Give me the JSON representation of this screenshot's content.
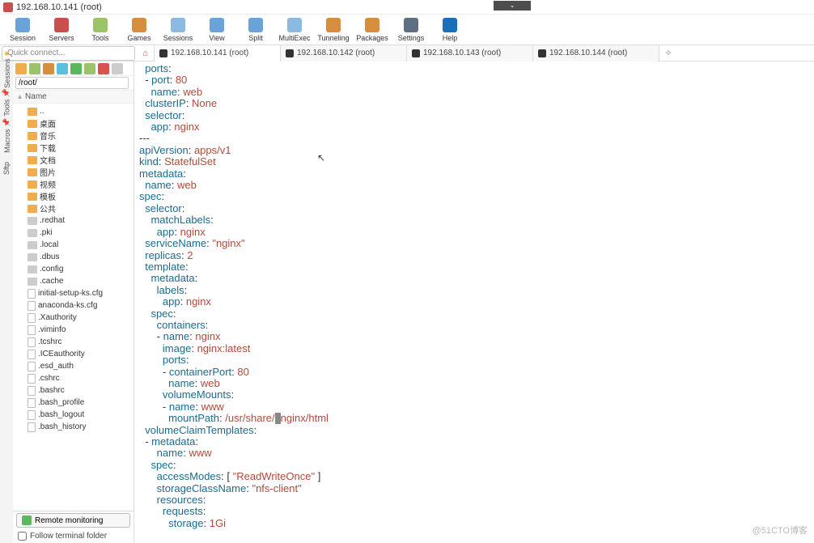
{
  "window_title": "192.168.10.141 (root)",
  "toolbar": [
    {
      "label": "Session",
      "color": "#6aa3d8"
    },
    {
      "label": "Servers",
      "color": "#c94f4f"
    },
    {
      "label": "Tools",
      "color": "#9cc26a"
    },
    {
      "label": "Games",
      "color": "#d68f3e"
    },
    {
      "label": "Sessions",
      "color": "#8bb9e0"
    },
    {
      "label": "View",
      "color": "#6aa3d8"
    },
    {
      "label": "Split",
      "color": "#6aa3d8"
    },
    {
      "label": "MultiExec",
      "color": "#8bb9e0"
    },
    {
      "label": "Tunneling",
      "color": "#d68f3e"
    },
    {
      "label": "Packages",
      "color": "#d68f3e"
    },
    {
      "label": "Settings",
      "color": "#5e6f82"
    },
    {
      "label": "Help",
      "color": "#1b6fb8"
    }
  ],
  "quick_connect_placeholder": "Quick connect...",
  "tabs": [
    {
      "label": "192.168.10.141 (root)",
      "active": true
    },
    {
      "label": "192.168.10.142 (root)",
      "active": false
    },
    {
      "label": "192.168.10.143 (root)",
      "active": false
    },
    {
      "label": "192.168.10.144 (root)",
      "active": false
    }
  ],
  "vtabs": [
    "Sessions",
    "Tools",
    "Macros",
    "Sftp"
  ],
  "sidebar": {
    "path_value": "/root/",
    "name_header": "Name",
    "tree": [
      {
        "t": "up",
        "label": ".."
      },
      {
        "t": "fld",
        "label": "桌面"
      },
      {
        "t": "fld",
        "label": "音乐"
      },
      {
        "t": "fld",
        "label": "下载"
      },
      {
        "t": "fld",
        "label": "文档"
      },
      {
        "t": "fld",
        "label": "图片"
      },
      {
        "t": "fld",
        "label": "视频"
      },
      {
        "t": "fld",
        "label": "模板"
      },
      {
        "t": "fld",
        "label": "公共"
      },
      {
        "t": "fldg",
        "label": ".redhat"
      },
      {
        "t": "fldg",
        "label": ".pki"
      },
      {
        "t": "fldg",
        "label": ".local"
      },
      {
        "t": "fldg",
        "label": ".dbus"
      },
      {
        "t": "fldg",
        "label": ".config"
      },
      {
        "t": "fldg",
        "label": ".cache"
      },
      {
        "t": "fl",
        "label": "initial-setup-ks.cfg"
      },
      {
        "t": "fl",
        "label": "anaconda-ks.cfg"
      },
      {
        "t": "fl",
        "label": ".Xauthority"
      },
      {
        "t": "fl",
        "label": ".viminfo"
      },
      {
        "t": "fl",
        "label": ".tcshrc"
      },
      {
        "t": "fl",
        "label": ".ICEauthority"
      },
      {
        "t": "fl",
        "label": ".esd_auth"
      },
      {
        "t": "fl",
        "label": ".cshrc"
      },
      {
        "t": "fl",
        "label": ".bashrc"
      },
      {
        "t": "fl",
        "label": ".bash_profile"
      },
      {
        "t": "fl",
        "label": ".bash_logout"
      },
      {
        "t": "fl",
        "label": ".bash_history"
      }
    ],
    "remote_monitoring": "Remote monitoring",
    "follow_terminal": "Follow terminal folder"
  },
  "terminal_lines": [
    [
      [
        "k",
        "  ports"
      ],
      [
        "p",
        ":"
      ]
    ],
    [
      [
        "d",
        "  - "
      ],
      [
        "k",
        "port"
      ],
      [
        "p",
        ": "
      ],
      [
        "n",
        "80"
      ]
    ],
    [
      [
        "p",
        "    "
      ],
      [
        "k",
        "name"
      ],
      [
        "p",
        ": "
      ],
      [
        "s",
        "web"
      ]
    ],
    [
      [
        "p",
        "  "
      ],
      [
        "k",
        "clusterIP"
      ],
      [
        "p",
        ": "
      ],
      [
        "s",
        "None"
      ]
    ],
    [
      [
        "p",
        "  "
      ],
      [
        "k",
        "selector"
      ],
      [
        "p",
        ":"
      ]
    ],
    [
      [
        "p",
        "    "
      ],
      [
        "k",
        "app"
      ],
      [
        "p",
        ": "
      ],
      [
        "s",
        "nginx"
      ]
    ],
    [
      [
        "d",
        "---"
      ]
    ],
    [
      [
        "k",
        "apiVersion"
      ],
      [
        "p",
        ": "
      ],
      [
        "s",
        "apps/v1"
      ]
    ],
    [
      [
        "k",
        "kind"
      ],
      [
        "p",
        ": "
      ],
      [
        "s",
        "StatefulSet"
      ]
    ],
    [
      [
        "k",
        "metadata"
      ],
      [
        "p",
        ":"
      ]
    ],
    [
      [
        "p",
        "  "
      ],
      [
        "k",
        "name"
      ],
      [
        "p",
        ": "
      ],
      [
        "s",
        "web"
      ]
    ],
    [
      [
        "k",
        "spec"
      ],
      [
        "p",
        ":"
      ]
    ],
    [
      [
        "p",
        "  "
      ],
      [
        "k",
        "selector"
      ],
      [
        "p",
        ":"
      ]
    ],
    [
      [
        "p",
        "    "
      ],
      [
        "k",
        "matchLabels"
      ],
      [
        "p",
        ":"
      ]
    ],
    [
      [
        "p",
        "      "
      ],
      [
        "k",
        "app"
      ],
      [
        "p",
        ": "
      ],
      [
        "s",
        "nginx"
      ]
    ],
    [
      [
        "p",
        "  "
      ],
      [
        "k",
        "serviceName"
      ],
      [
        "p",
        ": "
      ],
      [
        "s",
        "\"nginx\""
      ]
    ],
    [
      [
        "p",
        "  "
      ],
      [
        "k",
        "replicas"
      ],
      [
        "p",
        ": "
      ],
      [
        "n",
        "2"
      ]
    ],
    [
      [
        "p",
        "  "
      ],
      [
        "k",
        "template"
      ],
      [
        "p",
        ":"
      ]
    ],
    [
      [
        "p",
        "    "
      ],
      [
        "k",
        "metadata"
      ],
      [
        "p",
        ":"
      ]
    ],
    [
      [
        "p",
        "      "
      ],
      [
        "k",
        "labels"
      ],
      [
        "p",
        ":"
      ]
    ],
    [
      [
        "p",
        "        "
      ],
      [
        "k",
        "app"
      ],
      [
        "p",
        ": "
      ],
      [
        "s",
        "nginx"
      ]
    ],
    [
      [
        "p",
        "    "
      ],
      [
        "k",
        "spec"
      ],
      [
        "p",
        ":"
      ]
    ],
    [
      [
        "p",
        "      "
      ],
      [
        "k",
        "containers"
      ],
      [
        "p",
        ":"
      ]
    ],
    [
      [
        "d",
        "      - "
      ],
      [
        "k",
        "name"
      ],
      [
        "p",
        ": "
      ],
      [
        "s",
        "nginx"
      ]
    ],
    [
      [
        "p",
        "        "
      ],
      [
        "k",
        "image"
      ],
      [
        "p",
        ": "
      ],
      [
        "s",
        "nginx:latest"
      ]
    ],
    [
      [
        "p",
        "        "
      ],
      [
        "k",
        "ports"
      ],
      [
        "p",
        ":"
      ]
    ],
    [
      [
        "d",
        "        - "
      ],
      [
        "k",
        "containerPort"
      ],
      [
        "p",
        ": "
      ],
      [
        "n",
        "80"
      ]
    ],
    [
      [
        "p",
        "          "
      ],
      [
        "k",
        "name"
      ],
      [
        "p",
        ": "
      ],
      [
        "s",
        "web"
      ]
    ],
    [
      [
        "p",
        "        "
      ],
      [
        "k",
        "volumeMounts"
      ],
      [
        "p",
        ":"
      ]
    ],
    [
      [
        "d",
        "        - "
      ],
      [
        "k",
        "name"
      ],
      [
        "p",
        ": "
      ],
      [
        "s",
        "www"
      ]
    ],
    [
      [
        "p",
        "          "
      ],
      [
        "k",
        "mountPath"
      ],
      [
        "p",
        ": "
      ],
      [
        "s",
        "/usr/share/"
      ],
      [
        "c",
        ""
      ],
      [
        "s",
        "nginx/html"
      ]
    ],
    [
      [
        "p",
        "  "
      ],
      [
        "k",
        "volumeClaimTemplates"
      ],
      [
        "p",
        ":"
      ]
    ],
    [
      [
        "d",
        "  - "
      ],
      [
        "k",
        "metadata"
      ],
      [
        "p",
        ":"
      ]
    ],
    [
      [
        "p",
        "      "
      ],
      [
        "k",
        "name"
      ],
      [
        "p",
        ": "
      ],
      [
        "s",
        "www"
      ]
    ],
    [
      [
        "p",
        "    "
      ],
      [
        "k",
        "spec"
      ],
      [
        "p",
        ":"
      ]
    ],
    [
      [
        "p",
        "      "
      ],
      [
        "k",
        "accessModes"
      ],
      [
        "p",
        ": [ "
      ],
      [
        "s",
        "\"ReadWriteOnce\""
      ],
      [
        "p",
        " ]"
      ]
    ],
    [
      [
        "p",
        "      "
      ],
      [
        "k",
        "storageClassName"
      ],
      [
        "p",
        ": "
      ],
      [
        "s",
        "\"nfs-client\""
      ]
    ],
    [
      [
        "p",
        "      "
      ],
      [
        "k",
        "resources"
      ],
      [
        "p",
        ":"
      ]
    ],
    [
      [
        "p",
        "        "
      ],
      [
        "k",
        "requests"
      ],
      [
        "p",
        ":"
      ]
    ],
    [
      [
        "p",
        "          "
      ],
      [
        "k",
        "storage"
      ],
      [
        "p",
        ": "
      ],
      [
        "s",
        "1Gi"
      ]
    ]
  ],
  "watermark": "@51CTO博客"
}
